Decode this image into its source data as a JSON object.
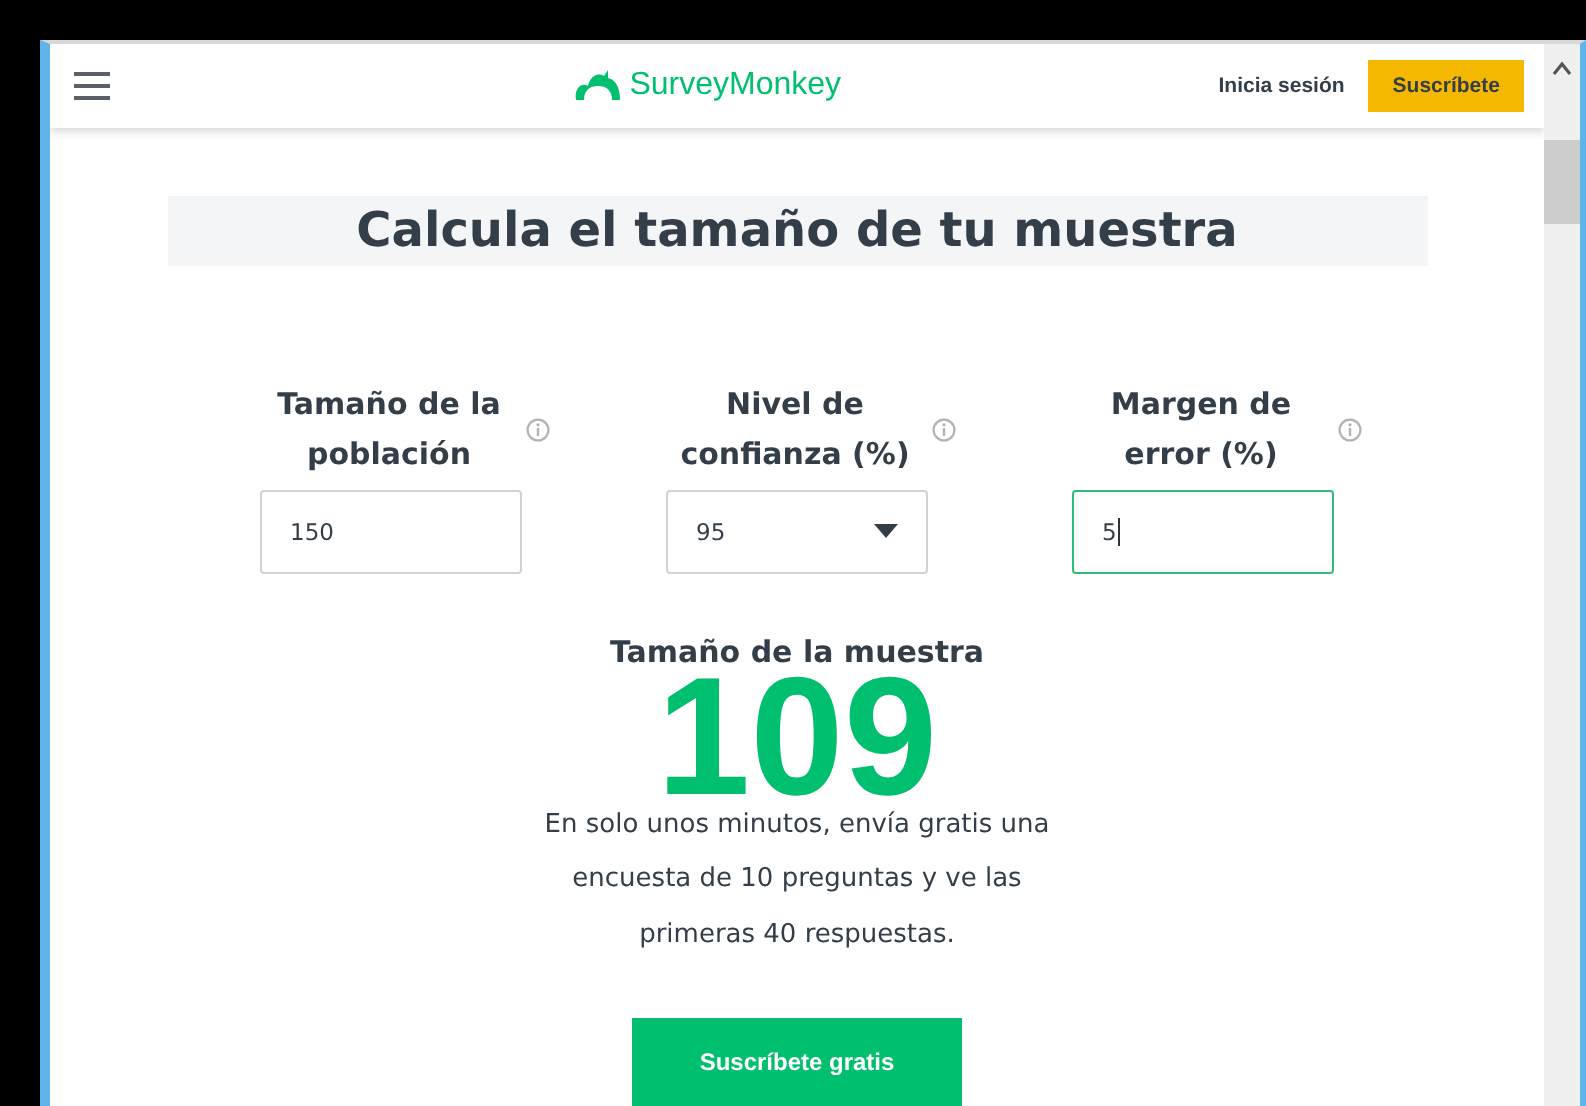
{
  "header": {
    "logo": "SurveyMonkey",
    "login": "Inicia sesión",
    "signup": "Suscríbete"
  },
  "title": "Calcula el tamaño de tu muestra",
  "fields": [
    {
      "kind": "text",
      "label": "Tamaño de la población",
      "value": "150",
      "focused": false
    },
    {
      "kind": "select",
      "label": "Nivel de confianza (%)",
      "value": "95",
      "focused": false
    },
    {
      "kind": "text",
      "label": "Margen de error (%)",
      "value": "5",
      "focused": true
    }
  ],
  "result": {
    "label": "Tamaño de la muestra",
    "value": "109"
  },
  "description": "En solo unos minutos, envía gratis una encuesta de 10 preguntas y ve las primeras 40 respuestas.",
  "cta": "Suscríbete gratis"
}
